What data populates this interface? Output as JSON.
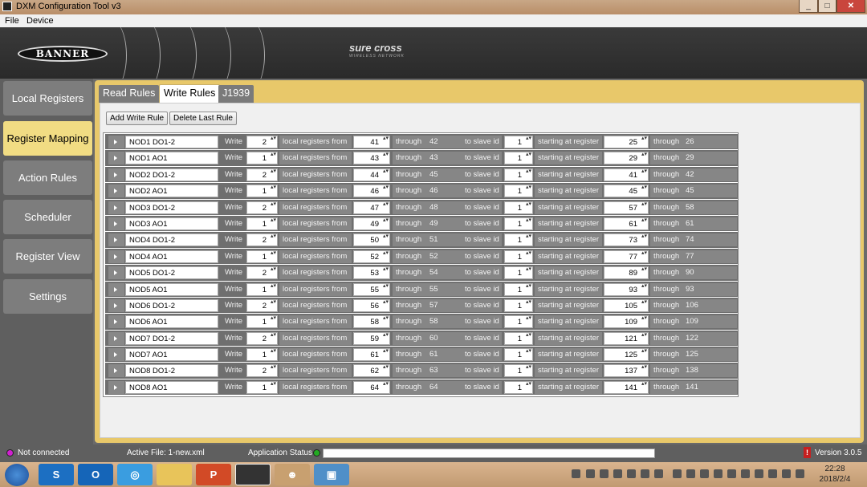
{
  "window": {
    "title": "DXM Configuration Tool v3",
    "min": "_",
    "max": "□",
    "close": "✕"
  },
  "menu": [
    "File",
    "Device"
  ],
  "branding": {
    "logo": "BANNER",
    "product": "sure cross",
    "tagline": "WIRELESS NETWORK"
  },
  "sidebar": [
    {
      "label": "Local Registers",
      "active": false
    },
    {
      "label": "Register Mapping",
      "active": true
    },
    {
      "label": "Action Rules",
      "active": false
    },
    {
      "label": "Scheduler",
      "active": false
    },
    {
      "label": "Register View",
      "active": false
    },
    {
      "label": "Settings",
      "active": false
    }
  ],
  "tabs": [
    {
      "label": "Read Rules",
      "active": false
    },
    {
      "label": "Write Rules",
      "active": true
    },
    {
      "label": "J1939",
      "active": false
    }
  ],
  "buttons": {
    "add": "Add Write Rule",
    "delete": "Delete Last Rule"
  },
  "row_labels": {
    "action": "Write",
    "local_from": "local registers from",
    "through": "through",
    "slave": "to slave id",
    "start": "starting at register"
  },
  "rules": [
    {
      "name": "NOD1 DO1-2",
      "count": "2",
      "from": "41",
      "to": "42",
      "slave": "1",
      "start": "25",
      "end": "26"
    },
    {
      "name": "NOD1 AO1",
      "count": "1",
      "from": "43",
      "to": "43",
      "slave": "1",
      "start": "29",
      "end": "29"
    },
    {
      "name": "NOD2 DO1-2",
      "count": "2",
      "from": "44",
      "to": "45",
      "slave": "1",
      "start": "41",
      "end": "42"
    },
    {
      "name": "NOD2 AO1",
      "count": "1",
      "from": "46",
      "to": "46",
      "slave": "1",
      "start": "45",
      "end": "45"
    },
    {
      "name": "NOD3 DO1-2",
      "count": "2",
      "from": "47",
      "to": "48",
      "slave": "1",
      "start": "57",
      "end": "58"
    },
    {
      "name": "NOD3 AO1",
      "count": "1",
      "from": "49",
      "to": "49",
      "slave": "1",
      "start": "61",
      "end": "61"
    },
    {
      "name": "NOD4 DO1-2",
      "count": "2",
      "from": "50",
      "to": "51",
      "slave": "1",
      "start": "73",
      "end": "74"
    },
    {
      "name": "NOD4 AO1",
      "count": "1",
      "from": "52",
      "to": "52",
      "slave": "1",
      "start": "77",
      "end": "77"
    },
    {
      "name": "NOD5 DO1-2",
      "count": "2",
      "from": "53",
      "to": "54",
      "slave": "1",
      "start": "89",
      "end": "90"
    },
    {
      "name": "NOD5 AO1",
      "count": "1",
      "from": "55",
      "to": "55",
      "slave": "1",
      "start": "93",
      "end": "93"
    },
    {
      "name": "NOD6 DO1-2",
      "count": "2",
      "from": "56",
      "to": "57",
      "slave": "1",
      "start": "105",
      "end": "106"
    },
    {
      "name": "NOD6 AO1",
      "count": "1",
      "from": "58",
      "to": "58",
      "slave": "1",
      "start": "109",
      "end": "109"
    },
    {
      "name": "NOD7 DO1-2",
      "count": "2",
      "from": "59",
      "to": "60",
      "slave": "1",
      "start": "121",
      "end": "122"
    },
    {
      "name": "NOD7 AO1",
      "count": "1",
      "from": "61",
      "to": "61",
      "slave": "1",
      "start": "125",
      "end": "125"
    },
    {
      "name": "NOD8 DO1-2",
      "count": "2",
      "from": "62",
      "to": "63",
      "slave": "1",
      "start": "137",
      "end": "138"
    },
    {
      "name": "NOD8 AO1",
      "count": "1",
      "from": "64",
      "to": "64",
      "slave": "1",
      "start": "141",
      "end": "141"
    }
  ],
  "status": {
    "connection": "Not connected",
    "connection_color": "#d020d0",
    "active_file": "Active File: 1-new.xml",
    "app_status_label": "Application Status",
    "app_status_color": "#22aa22",
    "version": "Version 3.0.5",
    "warning_mark": "!"
  },
  "taskbar": {
    "apps": [
      "start",
      "browser",
      "outlook",
      "maps",
      "file-explorer",
      "powerpoint",
      "dxm-tool",
      "qq",
      "image-viewer"
    ],
    "time": "22:28",
    "date": "2018/2/4"
  },
  "colors": {
    "accent": "#e8c86a",
    "active_nav": "#f1dc83",
    "row_bg": "#6f6f6f"
  }
}
